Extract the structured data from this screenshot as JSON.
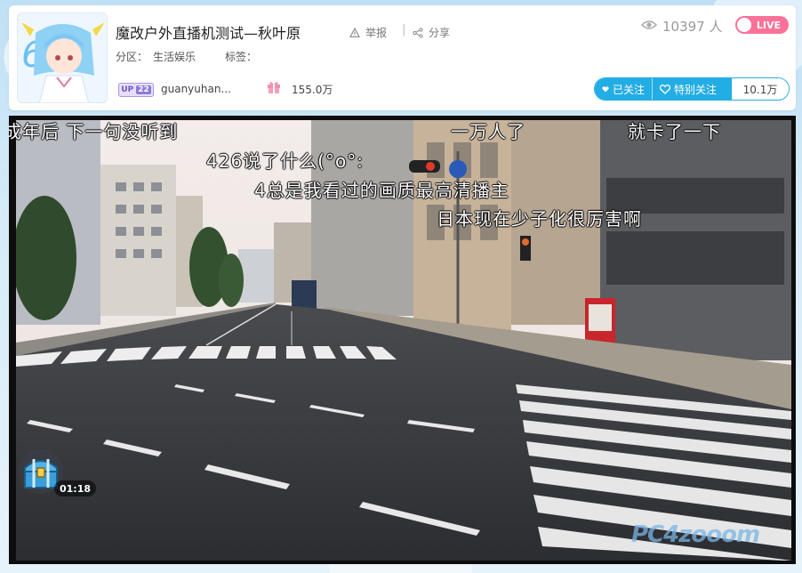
{
  "room": {
    "title": "魔改户外直播机测试—秋叶原",
    "report_label": "举报",
    "share_label": "分享",
    "area_label": "分区：",
    "area_value": "生活娱乐",
    "tags_label": "标签：",
    "viewers": "10397 人",
    "live_label": "LIVE"
  },
  "anchor": {
    "up_label": "UP",
    "level": "22",
    "name": "guanyuhan...",
    "gift_count": "155.0万"
  },
  "follow": {
    "follow_label": "已关注",
    "special_label": "特别关注",
    "fans_count": "10.1万"
  },
  "player": {
    "danmaku": [
      "成年后  下一句没听到",
      "一万人了",
      "就卡了一下",
      "426说了什么(°o°:",
      "4总是我看过的画质最高清播主",
      "日本现在少子化很厉害啊"
    ],
    "chest_timer": "01:18",
    "watermark": "PC4zooom"
  },
  "colors": {
    "accent_blue": "#23ade5",
    "live_pink": "#fb7299",
    "up_purple": "#8c7ad8"
  },
  "icons": {
    "report": "warning-icon",
    "share": "share-icon",
    "viewers": "eye-icon",
    "gift": "gift-icon",
    "follow": "heart-icon",
    "special": "heart-outline-icon",
    "chest": "treasure-chest-icon"
  }
}
